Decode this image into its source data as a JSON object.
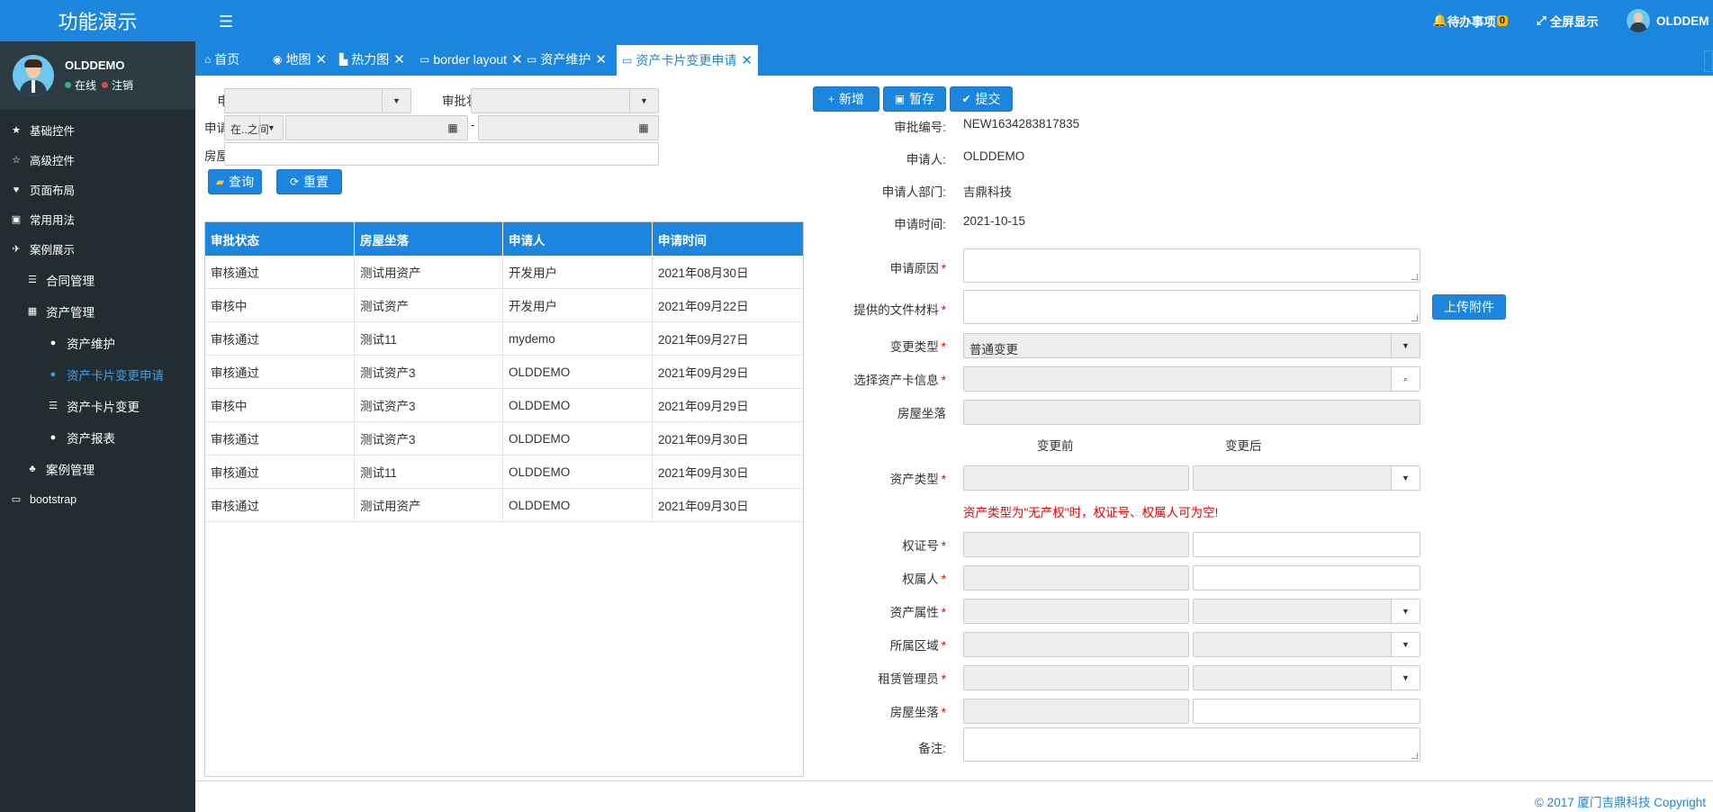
{
  "app": {
    "title": "功能演示"
  },
  "user": {
    "name": "OLDDEMO",
    "online": "在线",
    "logout": "注销"
  },
  "sidebar": {
    "items": [
      {
        "label": "基础控件",
        "icon": "star-icon"
      },
      {
        "label": "高级控件",
        "icon": "star-outline-icon"
      },
      {
        "label": "页面布局",
        "icon": "heart-icon"
      },
      {
        "label": "常用用法",
        "icon": "save-icon"
      },
      {
        "label": "案例展示",
        "icon": "plane-icon"
      },
      {
        "label": "合同管理",
        "icon": "list-icon"
      },
      {
        "label": "资产管理",
        "icon": "grid-icon"
      },
      {
        "label": "资产维护",
        "icon": "user-icon"
      },
      {
        "label": "资产卡片变更申请",
        "icon": "user-icon"
      },
      {
        "label": "资产卡片变更",
        "icon": "list-icon"
      },
      {
        "label": "资产报表",
        "icon": "user-icon"
      },
      {
        "label": "案例管理",
        "icon": "sitemap-icon"
      },
      {
        "label": "bootstrap",
        "icon": "money-icon"
      }
    ]
  },
  "topbar": {
    "todo": "待办事项",
    "todo_count": "0",
    "fullscreen": "全屏显示",
    "user": "OLDDEM"
  },
  "tabs": [
    {
      "label": "首页"
    },
    {
      "label": "地图"
    },
    {
      "label": "热力图"
    },
    {
      "label": "border layout"
    },
    {
      "label": "资产维护"
    },
    {
      "label": "资产卡片变更申请"
    }
  ],
  "query": {
    "applicant_label": "申请人",
    "status_label": "审批状态",
    "time_label": "申请时间",
    "time_op": "在..之间",
    "date_sep": "-",
    "location_label": "房屋坐落",
    "search_btn": "查询",
    "reset_btn": "重置"
  },
  "grid": {
    "headers": [
      "审批状态",
      "房屋坐落",
      "申请人",
      "申请时间"
    ],
    "rows": [
      [
        "审核通过",
        "测试用资产",
        "开发用户",
        "2021年08月30日"
      ],
      [
        "审核中",
        "测试资产",
        "开发用户",
        "2021年09月22日"
      ],
      [
        "审核通过",
        "测试11",
        "mydemo",
        "2021年09月27日"
      ],
      [
        "审核通过",
        "测试资产3",
        "OLDDEMO",
        "2021年09月29日"
      ],
      [
        "审核中",
        "测试资产3",
        "OLDDEMO",
        "2021年09月29日"
      ],
      [
        "审核通过",
        "测试资产3",
        "OLDDEMO",
        "2021年09月30日"
      ],
      [
        "审核通过",
        "测试11",
        "OLDDEMO",
        "2021年09月30日"
      ],
      [
        "审核通过",
        "测试用资产",
        "OLDDEMO",
        "2021年09月30日"
      ]
    ]
  },
  "form": {
    "add_btn": "新增",
    "save_btn": "暂存",
    "submit_btn": "提交",
    "approval_no_label": "审批编号:",
    "approval_no": "NEW1634283817835",
    "applicant_label": "申请人:",
    "applicant": "OLDDEMO",
    "dept_label": "申请人部门:",
    "dept": "吉鼎科技",
    "time_label": "申请时间:",
    "time": "2021-10-15",
    "reason_label": "申请原因",
    "files_label": "提供的文件材料",
    "upload_btn": "上传附件",
    "change_type_label": "变更类型",
    "change_type": "普通变更",
    "card_label": "选择资产卡信息",
    "location_label": "房屋坐落",
    "before": "变更前",
    "after": "变更后",
    "asset_type_label": "资产类型",
    "warning": "资产类型为\"无产权\"时，权证号、权属人可为空!",
    "cert_label": "权证号",
    "owner_label": "权属人",
    "attr_label": "资产属性",
    "area_label": "所属区域",
    "manager_label": "租赁管理员",
    "location2_label": "房屋坐落",
    "note_label": "备注:"
  },
  "footer": {
    "text": "© 2017 厦门吉鼎科技 Copyright"
  }
}
